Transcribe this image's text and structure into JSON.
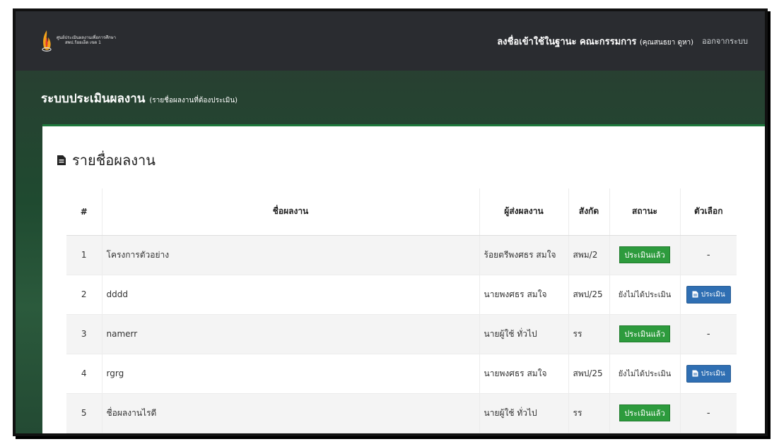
{
  "brand": {
    "line1": "ศูนย์ประเมินผลงานเพื่อการศึกษา",
    "line2": "สพป.ร้อยเอ็ด เขต 1"
  },
  "topnav": {
    "login_as": "ลงชื่อเข้าใช้ในฐานะ คณะกรรมการ",
    "login_user": "(คุณสนธยา ดูหา)",
    "logout": "ออกจากระบบ"
  },
  "page_header": {
    "title": "ระบบประเมินผลงาน",
    "subtitle": "(รายชื่อผลงานที่ต้องประเมิน)"
  },
  "panel": {
    "title": "รายชื่อผลงาน"
  },
  "table": {
    "headers": {
      "num": "#",
      "name": "ชื่อผลงาน",
      "sender": "ผู้ส่งผลงาน",
      "unit": "สังกัด",
      "status": "สถานะ",
      "action": "ตัวเลือก"
    },
    "rows": [
      {
        "num": "1",
        "name": "โครงการตัวอย่าง",
        "sender": "ร้อยตรีพงศธร สมใจ",
        "unit": "สพม/2",
        "status": "ประเมินแล้ว",
        "status_type": "done",
        "action": "-"
      },
      {
        "num": "2",
        "name": "dddd",
        "sender": "นายพงศธร สมใจ",
        "unit": "สพป/25",
        "status": "ยังไม่ได้ประเมิน",
        "status_type": "pending",
        "action": "ประเมิน"
      },
      {
        "num": "3",
        "name": "namerr",
        "sender": "นายผู้ใช้ ทั่วไป",
        "unit": "รร",
        "status": "ประเมินแล้ว",
        "status_type": "done",
        "action": "-"
      },
      {
        "num": "4",
        "name": "rgrg",
        "sender": "นายพงศธร สมใจ",
        "unit": "สพป/25",
        "status": "ยังไม่ได้ประเมิน",
        "status_type": "pending",
        "action": "ประเมิน"
      },
      {
        "num": "5",
        "name": "ชื่อผลงานไรดี",
        "sender": "นายผู้ใช้ ทั่วไป",
        "unit": "รร",
        "status": "ประเมินแล้ว",
        "status_type": "done",
        "action": "-"
      }
    ]
  },
  "colors": {
    "topbar": "#2a2c30",
    "panel_accent": "#1f7a3d",
    "status_done": "#2d9b3d",
    "button": "#2f6fb3"
  }
}
